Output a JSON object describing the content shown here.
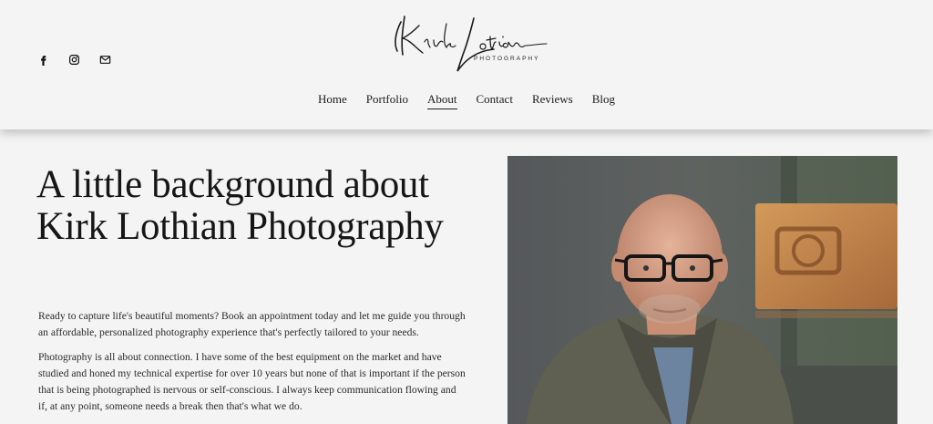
{
  "header": {
    "social": [
      {
        "name": "facebook-icon"
      },
      {
        "name": "instagram-icon"
      },
      {
        "name": "mail-icon"
      }
    ],
    "logo": {
      "script_text": "Kirk Lothian",
      "sub_text": "PHOTOGRAPHY"
    },
    "nav": [
      {
        "label": "Home",
        "active": false
      },
      {
        "label": "Portfolio",
        "active": false
      },
      {
        "label": "About",
        "active": true
      },
      {
        "label": "Contact",
        "active": false
      },
      {
        "label": "Reviews",
        "active": false
      },
      {
        "label": "Blog",
        "active": false
      }
    ]
  },
  "main": {
    "headline": "A little background about Kirk Lothian Photography",
    "paragraphs": [
      "Ready to capture life's beautiful moments? Book an appointment today and let me guide you through an affordable, personalized photography experience that's perfectly tailored to your needs.",
      "Photography is all about connection.  I have some of the best equipment on the market and have studied and honed my technical expertise for over 10 years but none of that is important if the person that is being photographed is nervous or self-conscious.  I always keep communication flowing and if, at any point, someone needs a break then that's what we do."
    ]
  },
  "colors": {
    "background": "#f4f4f4",
    "text": "#1c1c1c"
  }
}
